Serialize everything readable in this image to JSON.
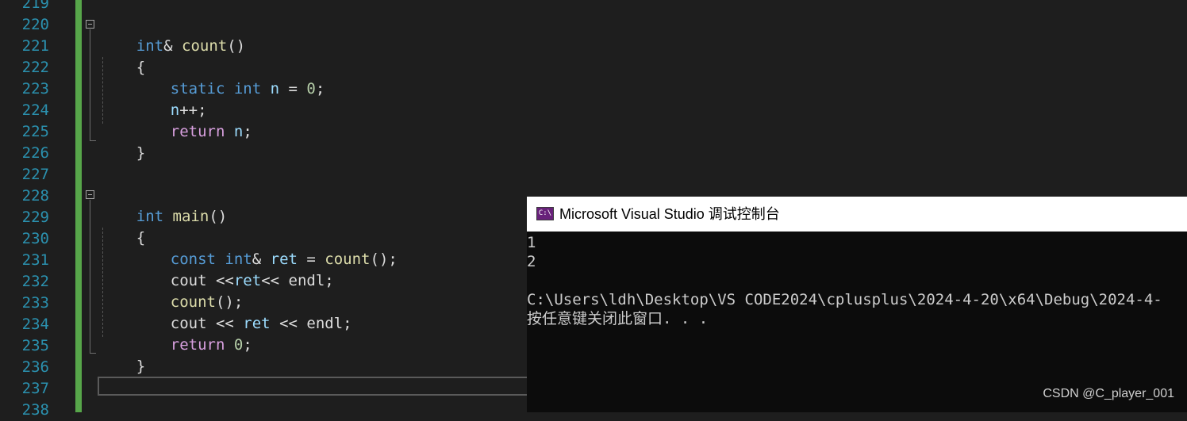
{
  "editor": {
    "line_numbers": [
      "219",
      "220",
      "221",
      "222",
      "223",
      "224",
      "225",
      "226",
      "227",
      "228",
      "229",
      "230",
      "231",
      "232",
      "233",
      "234",
      "235",
      "236",
      "237",
      "238"
    ],
    "colors": {
      "background": "#1e1e1e",
      "line_number": "#2b91af",
      "keyword": "#569cd6",
      "control_keyword": "#d8a0df",
      "function": "#dcdcaa",
      "variable": "#9cdcfe",
      "number": "#b5cea8",
      "change_bar": "#57a64a"
    },
    "code": {
      "l220": {
        "t1": "int",
        "t2": "&",
        "t3": " ",
        "t4": "count",
        "t5": "()"
      },
      "l221": {
        "t1": "{"
      },
      "l222": {
        "t1": "static",
        "t2": " ",
        "t3": "int",
        "t4": " ",
        "t5": "n",
        "t6": " = ",
        "t7": "0",
        "t8": ";"
      },
      "l223": {
        "t1": "n",
        "t2": "++;"
      },
      "l224": {
        "t1": "return",
        "t2": " ",
        "t3": "n",
        "t4": ";"
      },
      "l225": {
        "t1": "}"
      },
      "l228": {
        "t1": "int",
        "t2": " ",
        "t3": "main",
        "t4": "()"
      },
      "l229": {
        "t1": "{"
      },
      "l230": {
        "t1": "const",
        "t2": " ",
        "t3": "int",
        "t4": "& ",
        "t5": "ret",
        "t6": " = ",
        "t7": "count",
        "t8": "();"
      },
      "l231": {
        "t1": "cout",
        "t2": " <<",
        "t3": "ret",
        "t4": "<< ",
        "t5": "endl",
        "t6": ";"
      },
      "l232": {
        "t1": "count",
        "t2": "();"
      },
      "l233": {
        "t1": "cout",
        "t2": " << ",
        "t3": "ret",
        "t4": " << ",
        "t5": "endl",
        "t6": ";"
      },
      "l234": {
        "t1": "return",
        "t2": " ",
        "t3": "0",
        "t4": ";"
      },
      "l235": {
        "t1": "}"
      }
    }
  },
  "console": {
    "icon_text": "C:\\",
    "title": "Microsoft Visual Studio 调试控制台",
    "output_lines": [
      "1",
      "2",
      "",
      "C:\\Users\\ldh\\Desktop\\VS CODE2024\\cplusplus\\2024-4-20\\x64\\Debug\\2024-4-",
      "按任意键关闭此窗口. . ."
    ]
  },
  "watermark": "CSDN @C_player_001"
}
